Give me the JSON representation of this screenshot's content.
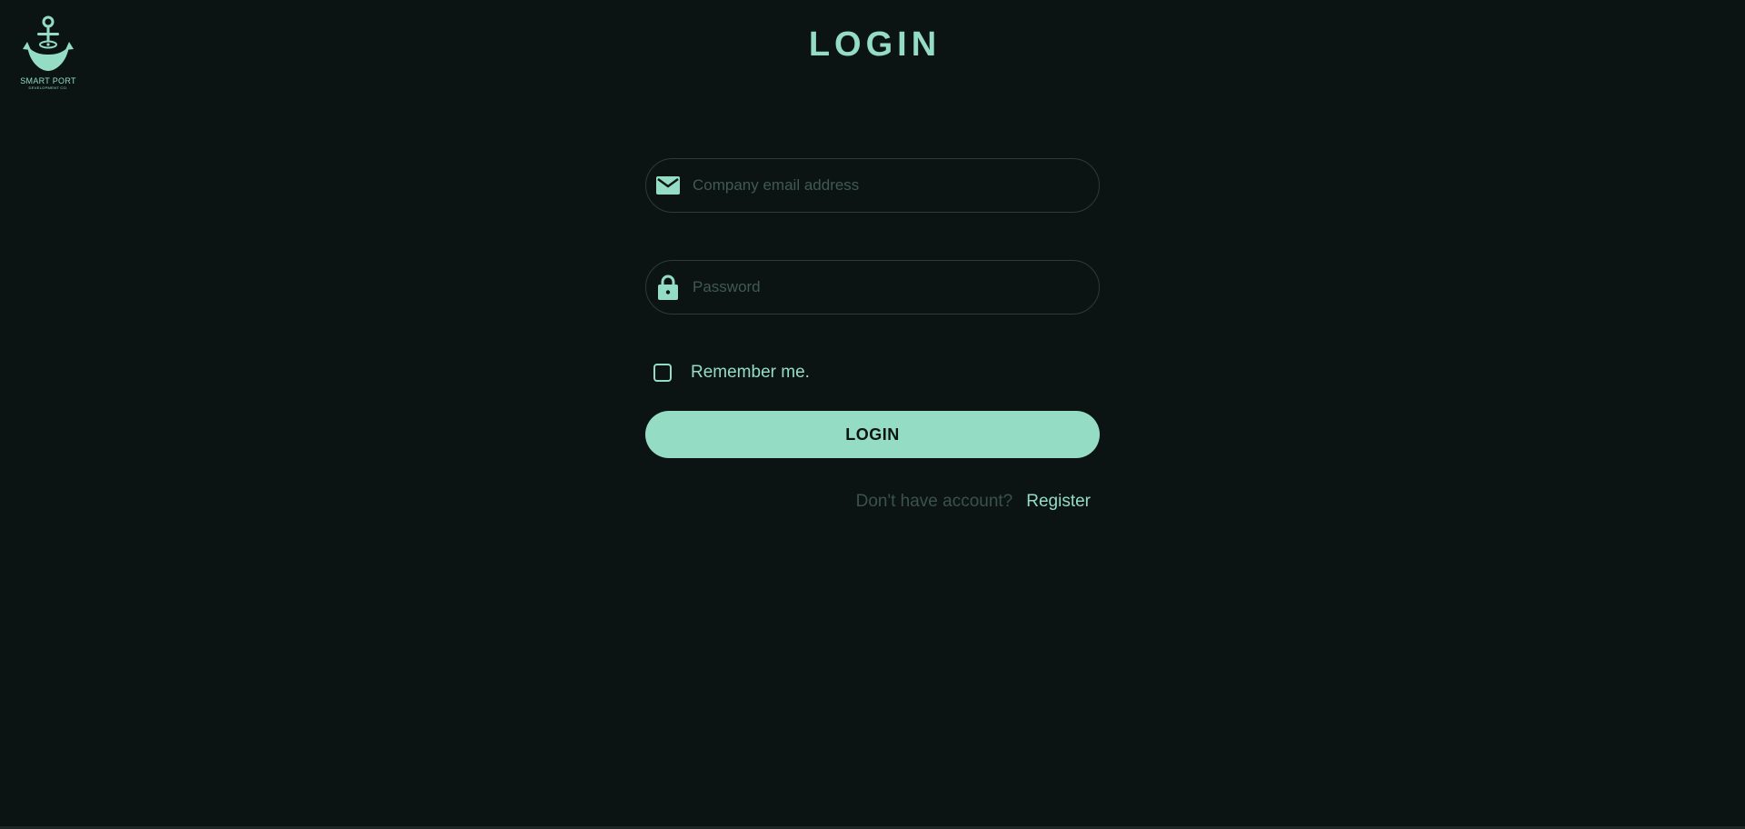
{
  "colors": {
    "background": "#0b1412",
    "accent": "#94dcc4",
    "border": "#2c3c38",
    "placeholder": "#3f5a52",
    "muted": "#3a524b"
  },
  "logo": {
    "icon": "anchor-icon",
    "name": "SMART PORT",
    "subtitle": "DEVELOPMENT CO."
  },
  "page": {
    "title": "LOGIN"
  },
  "form": {
    "email": {
      "icon": "envelope-icon",
      "placeholder": "Company email address",
      "value": ""
    },
    "password": {
      "icon": "lock-icon",
      "placeholder": "Password",
      "value": ""
    },
    "remember": {
      "label": "Remember me.",
      "checked": false
    },
    "submit_label": "LOGIN",
    "register_prompt": "Don't have account?",
    "register_link": "Register"
  }
}
